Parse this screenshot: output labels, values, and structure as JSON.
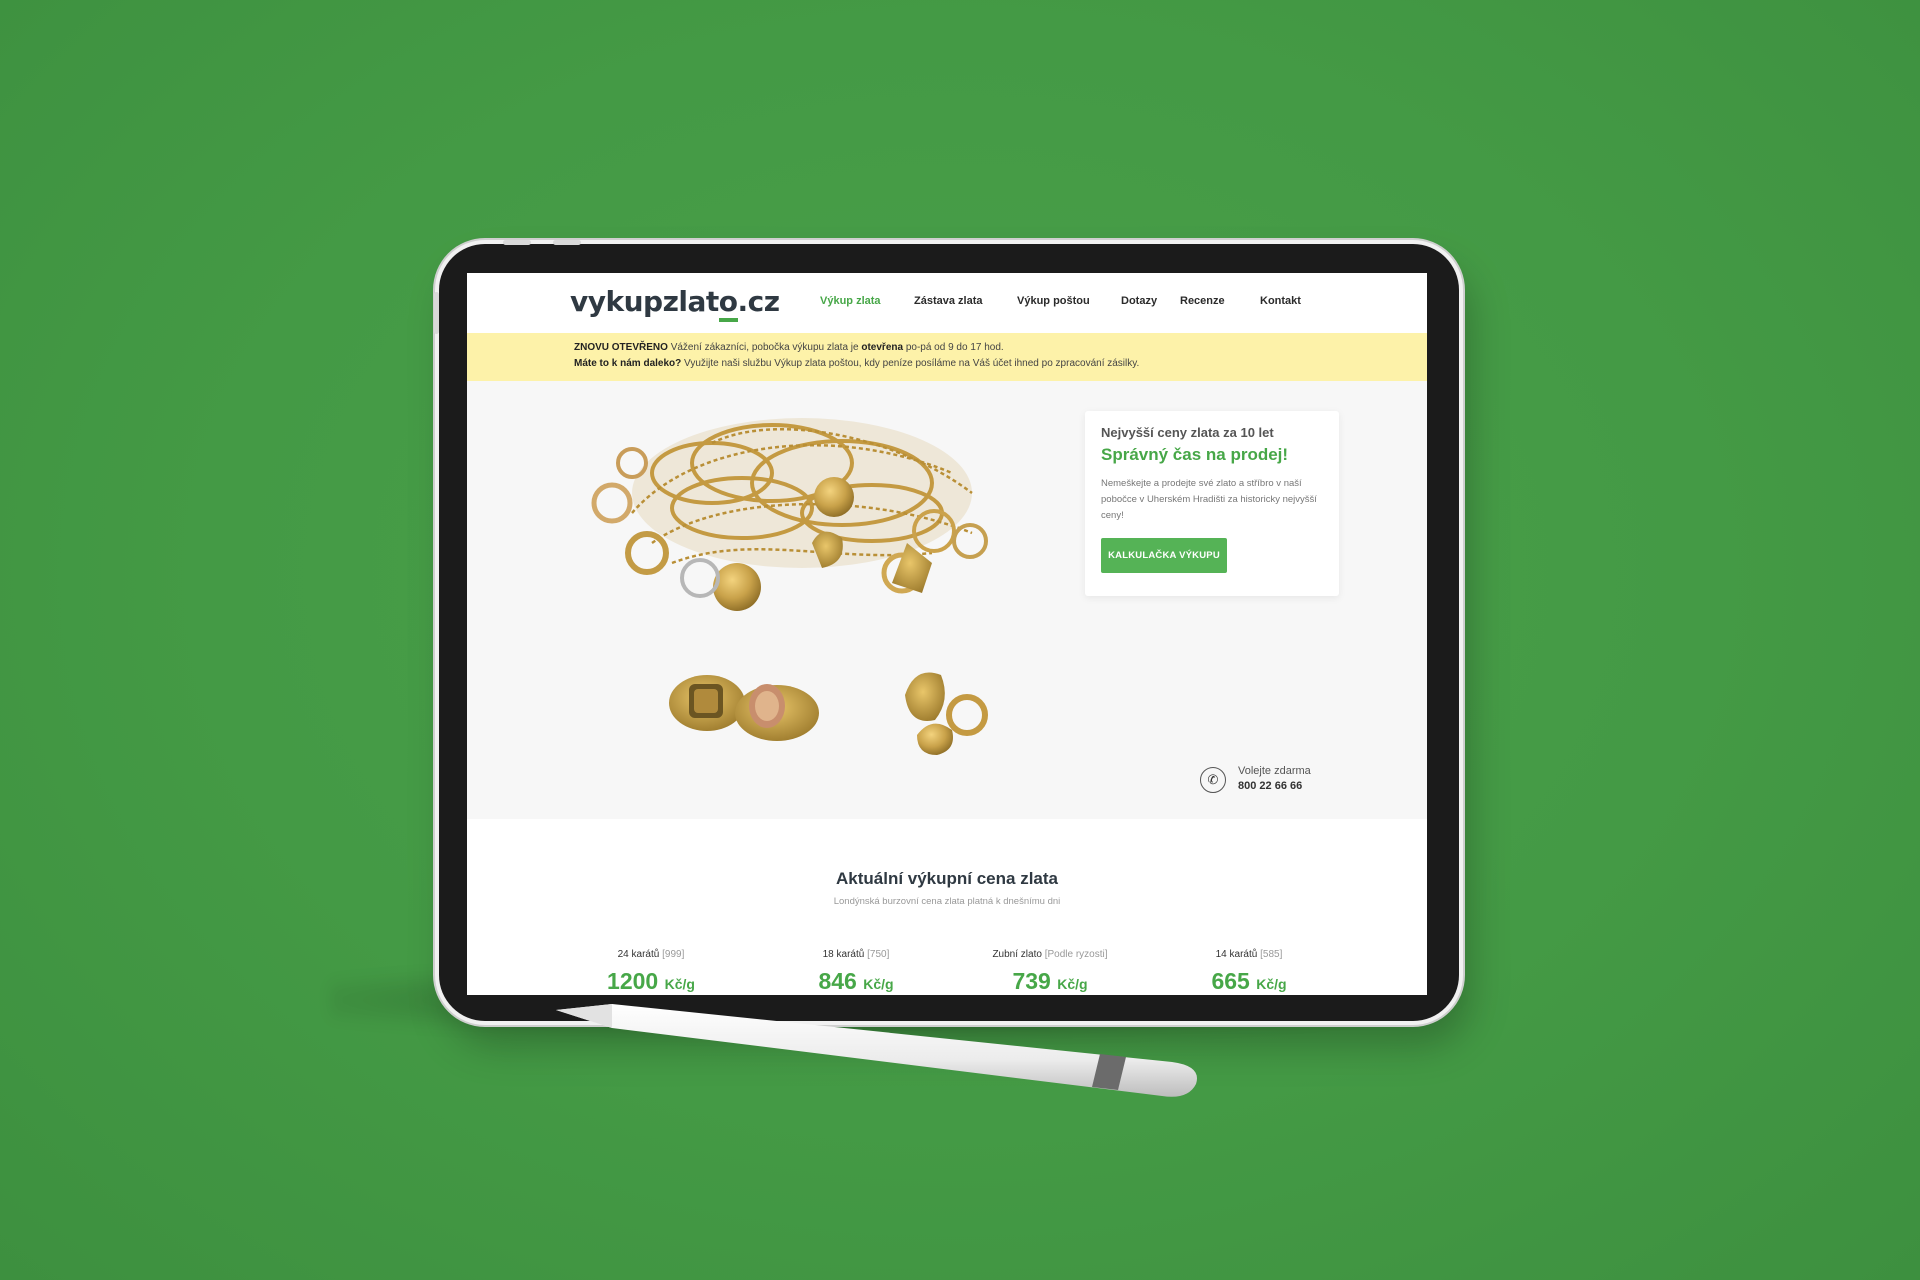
{
  "site": {
    "logo": {
      "part1": "vykupzlat",
      "o": "o",
      "part2": ".cz"
    },
    "nav": [
      {
        "label": "Výkup zlata",
        "active": true
      },
      {
        "label": "Zástava zlata",
        "active": false
      },
      {
        "label": "Výkup poštou",
        "active": false
      },
      {
        "label": "Dotazy",
        "active": false
      },
      {
        "label": "Recenze",
        "active": false
      },
      {
        "label": "Kontakt",
        "active": false
      }
    ],
    "notice": {
      "line1_bold": "ZNOVU OTEVŘENO",
      "line1_a": "Vážení zákazníci, pobočka výkupu zlata je",
      "line1_bold2": "otevřena",
      "line1_b": "po-pá od 9 do 17 hod.",
      "line2_bold": "Máte to k nám daleko?",
      "line2": "Využijte naši službu Výkup zlata poštou, kdy peníze posíláme na Váš účet ihned po zpracování zásilky."
    },
    "hero": {
      "kicker": "Nejvyšší ceny zlata za 10 let",
      "headline": "Správný čas na prodej!",
      "text": "Nemeškejte a prodejte své zlato a stříbro v naší pobočce v Uherském Hradišti za historicky nejvyšší ceny!",
      "cta": "KALKULAČKA VÝKUPU",
      "call_label": "Volejte zdarma",
      "call_number": "800 22 66 66"
    },
    "prices": {
      "title": "Aktuální výkupní cena zlata",
      "subtitle": "Londýnská burzovní cena zlata platná k dnešnímu dni",
      "unit": "Kč/g",
      "items": [
        {
          "label": "24 karátů",
          "note": "[999]",
          "value": "1200"
        },
        {
          "label": "18 karátů",
          "note": "[750]",
          "value": "846"
        },
        {
          "label": "Zubní zlato",
          "note": "[Podle ryzosti]",
          "value": "739"
        },
        {
          "label": "14 karátů",
          "note": "[585]",
          "value": "665"
        }
      ]
    }
  },
  "colors": {
    "background": "#449a45",
    "accent": "#47a748",
    "notice": "#fdf2a9",
    "gold": "#c9a24a"
  },
  "icons": {
    "phone": "phone-icon"
  }
}
